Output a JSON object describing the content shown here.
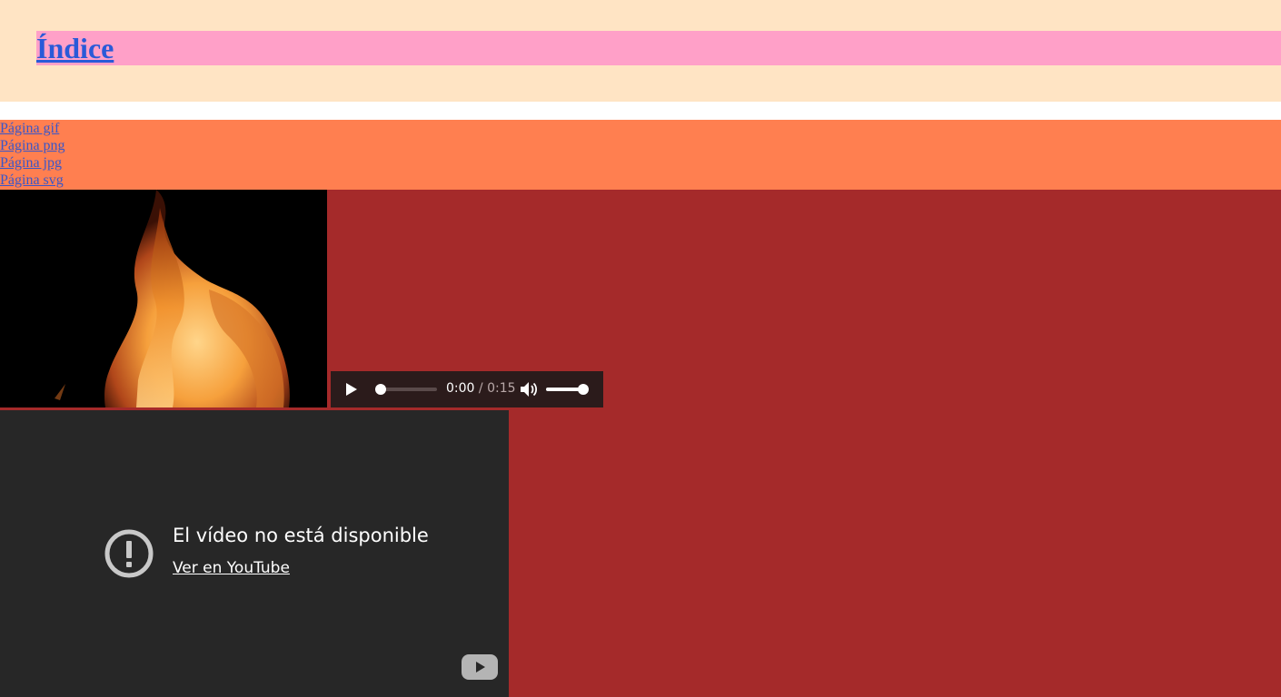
{
  "header": {
    "title": "Índice"
  },
  "nav": {
    "links": [
      "Página gif",
      "Página png",
      "Página jpg",
      "Página svg"
    ]
  },
  "audio": {
    "current_time": "0:00",
    "separator": " / ",
    "duration": "0:15",
    "progress": 0,
    "volume": 1.0
  },
  "youtube": {
    "message": "El vídeo no está disponible",
    "watch_link": "Ver en YouTube"
  },
  "colors": {
    "header_bg": "#ffe4c4",
    "title_bar_bg": "#ffa0c8",
    "nav_bg": "#ff7f50",
    "media_bg": "#a52a2a",
    "link": "#2a5ad8"
  },
  "icons": {
    "play": "play-icon",
    "volume": "volume-icon",
    "error": "error-icon",
    "youtube": "youtube-logo-icon"
  }
}
